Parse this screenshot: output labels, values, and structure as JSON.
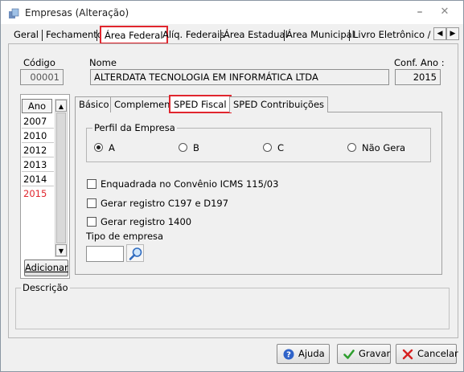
{
  "window": {
    "title": "Empresas (Alteração)",
    "min_glyph": "–",
    "close_glyph": "✕"
  },
  "top_tabs": [
    "Geral",
    "Fechamento",
    "Área Federal",
    "Alíq. Federais",
    "Área Estadual",
    "Área Municipal",
    "Livro Eletrônico / SF"
  ],
  "top_tab_scroll": {
    "left": "◀",
    "right": "▶"
  },
  "header": {
    "codigo_label": "Código",
    "codigo_value": "00001",
    "nome_label": "Nome",
    "nome_value": "ALTERDATA TECNOLOGIA EM INFORMÁTICA LTDA",
    "conf_ano_label": "Conf. Ano :",
    "conf_ano_value": "2015"
  },
  "years": {
    "header": "Ano",
    "items": [
      "2007",
      "2010",
      "2012",
      "2013",
      "2014",
      "2015"
    ],
    "selected": "2015",
    "up": "▲",
    "down": "▼"
  },
  "adicionar_label": "Adicionar",
  "inner_tabs": [
    "Básico",
    "Complemento",
    "SPED Fiscal",
    "SPED Contribuições"
  ],
  "perfil": {
    "legend": "Perfil da Empresa",
    "options": [
      "A",
      "B",
      "C",
      "Não Gera"
    ],
    "selected": "A"
  },
  "checks": [
    "Enquadrada no Convênio ICMS 115/03",
    "Gerar registro C197 e D197",
    "Gerar registro 1400"
  ],
  "tipo_empresa_label": "Tipo de empresa",
  "descricao_label": "Descrição",
  "buttons": {
    "ajuda": "Ajuda",
    "gravar": "Gravar",
    "cancelar": "Cancelar"
  },
  "colors": {
    "highlight": "#e0262e",
    "selected_year": "#e0262e",
    "gravar_icon": "#2e9e2e",
    "cancelar_icon": "#d62020",
    "ajuda_icon": "#2f63c9"
  }
}
